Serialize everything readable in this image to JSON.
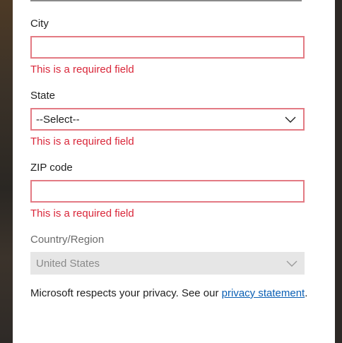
{
  "form": {
    "city": {
      "label": "City",
      "value": "",
      "error": "This is a required field"
    },
    "state": {
      "label": "State",
      "selected": "--Select--",
      "error": "This is a required field"
    },
    "zip": {
      "label": "ZIP code",
      "value": "",
      "error": "This is a required field"
    },
    "country": {
      "label": "Country/Region",
      "selected": "United States",
      "disabled": true
    }
  },
  "privacy": {
    "text": "Microsoft respects your privacy. See our",
    "link": "privacy statement",
    "suffix": "."
  },
  "colors": {
    "error": "#d9273a",
    "error_border": "#e37a83",
    "link": "#0a5fb4",
    "disabled_bg": "#e6e6e6"
  }
}
